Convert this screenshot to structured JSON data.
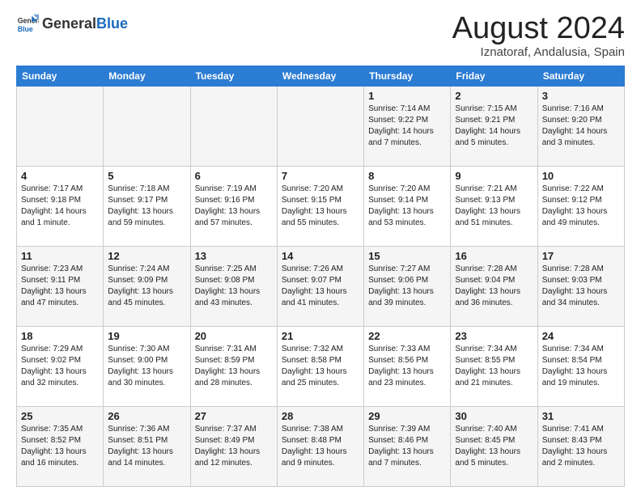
{
  "header": {
    "logo_general": "General",
    "logo_blue": "Blue",
    "month_title": "August 2024",
    "location": "Iznatoraf, Andalusia, Spain"
  },
  "days_of_week": [
    "Sunday",
    "Monday",
    "Tuesday",
    "Wednesday",
    "Thursday",
    "Friday",
    "Saturday"
  ],
  "weeks": [
    [
      {
        "day": "",
        "info": ""
      },
      {
        "day": "",
        "info": ""
      },
      {
        "day": "",
        "info": ""
      },
      {
        "day": "",
        "info": ""
      },
      {
        "day": "1",
        "info": "Sunrise: 7:14 AM\nSunset: 9:22 PM\nDaylight: 14 hours\nand 7 minutes."
      },
      {
        "day": "2",
        "info": "Sunrise: 7:15 AM\nSunset: 9:21 PM\nDaylight: 14 hours\nand 5 minutes."
      },
      {
        "day": "3",
        "info": "Sunrise: 7:16 AM\nSunset: 9:20 PM\nDaylight: 14 hours\nand 3 minutes."
      }
    ],
    [
      {
        "day": "4",
        "info": "Sunrise: 7:17 AM\nSunset: 9:18 PM\nDaylight: 14 hours\nand 1 minute."
      },
      {
        "day": "5",
        "info": "Sunrise: 7:18 AM\nSunset: 9:17 PM\nDaylight: 13 hours\nand 59 minutes."
      },
      {
        "day": "6",
        "info": "Sunrise: 7:19 AM\nSunset: 9:16 PM\nDaylight: 13 hours\nand 57 minutes."
      },
      {
        "day": "7",
        "info": "Sunrise: 7:20 AM\nSunset: 9:15 PM\nDaylight: 13 hours\nand 55 minutes."
      },
      {
        "day": "8",
        "info": "Sunrise: 7:20 AM\nSunset: 9:14 PM\nDaylight: 13 hours\nand 53 minutes."
      },
      {
        "day": "9",
        "info": "Sunrise: 7:21 AM\nSunset: 9:13 PM\nDaylight: 13 hours\nand 51 minutes."
      },
      {
        "day": "10",
        "info": "Sunrise: 7:22 AM\nSunset: 9:12 PM\nDaylight: 13 hours\nand 49 minutes."
      }
    ],
    [
      {
        "day": "11",
        "info": "Sunrise: 7:23 AM\nSunset: 9:11 PM\nDaylight: 13 hours\nand 47 minutes."
      },
      {
        "day": "12",
        "info": "Sunrise: 7:24 AM\nSunset: 9:09 PM\nDaylight: 13 hours\nand 45 minutes."
      },
      {
        "day": "13",
        "info": "Sunrise: 7:25 AM\nSunset: 9:08 PM\nDaylight: 13 hours\nand 43 minutes."
      },
      {
        "day": "14",
        "info": "Sunrise: 7:26 AM\nSunset: 9:07 PM\nDaylight: 13 hours\nand 41 minutes."
      },
      {
        "day": "15",
        "info": "Sunrise: 7:27 AM\nSunset: 9:06 PM\nDaylight: 13 hours\nand 39 minutes."
      },
      {
        "day": "16",
        "info": "Sunrise: 7:28 AM\nSunset: 9:04 PM\nDaylight: 13 hours\nand 36 minutes."
      },
      {
        "day": "17",
        "info": "Sunrise: 7:28 AM\nSunset: 9:03 PM\nDaylight: 13 hours\nand 34 minutes."
      }
    ],
    [
      {
        "day": "18",
        "info": "Sunrise: 7:29 AM\nSunset: 9:02 PM\nDaylight: 13 hours\nand 32 minutes."
      },
      {
        "day": "19",
        "info": "Sunrise: 7:30 AM\nSunset: 9:00 PM\nDaylight: 13 hours\nand 30 minutes."
      },
      {
        "day": "20",
        "info": "Sunrise: 7:31 AM\nSunset: 8:59 PM\nDaylight: 13 hours\nand 28 minutes."
      },
      {
        "day": "21",
        "info": "Sunrise: 7:32 AM\nSunset: 8:58 PM\nDaylight: 13 hours\nand 25 minutes."
      },
      {
        "day": "22",
        "info": "Sunrise: 7:33 AM\nSunset: 8:56 PM\nDaylight: 13 hours\nand 23 minutes."
      },
      {
        "day": "23",
        "info": "Sunrise: 7:34 AM\nSunset: 8:55 PM\nDaylight: 13 hours\nand 21 minutes."
      },
      {
        "day": "24",
        "info": "Sunrise: 7:34 AM\nSunset: 8:54 PM\nDaylight: 13 hours\nand 19 minutes."
      }
    ],
    [
      {
        "day": "25",
        "info": "Sunrise: 7:35 AM\nSunset: 8:52 PM\nDaylight: 13 hours\nand 16 minutes."
      },
      {
        "day": "26",
        "info": "Sunrise: 7:36 AM\nSunset: 8:51 PM\nDaylight: 13 hours\nand 14 minutes."
      },
      {
        "day": "27",
        "info": "Sunrise: 7:37 AM\nSunset: 8:49 PM\nDaylight: 13 hours\nand 12 minutes."
      },
      {
        "day": "28",
        "info": "Sunrise: 7:38 AM\nSunset: 8:48 PM\nDaylight: 13 hours\nand 9 minutes."
      },
      {
        "day": "29",
        "info": "Sunrise: 7:39 AM\nSunset: 8:46 PM\nDaylight: 13 hours\nand 7 minutes."
      },
      {
        "day": "30",
        "info": "Sunrise: 7:40 AM\nSunset: 8:45 PM\nDaylight: 13 hours\nand 5 minutes."
      },
      {
        "day": "31",
        "info": "Sunrise: 7:41 AM\nSunset: 8:43 PM\nDaylight: 13 hours\nand 2 minutes."
      }
    ]
  ]
}
